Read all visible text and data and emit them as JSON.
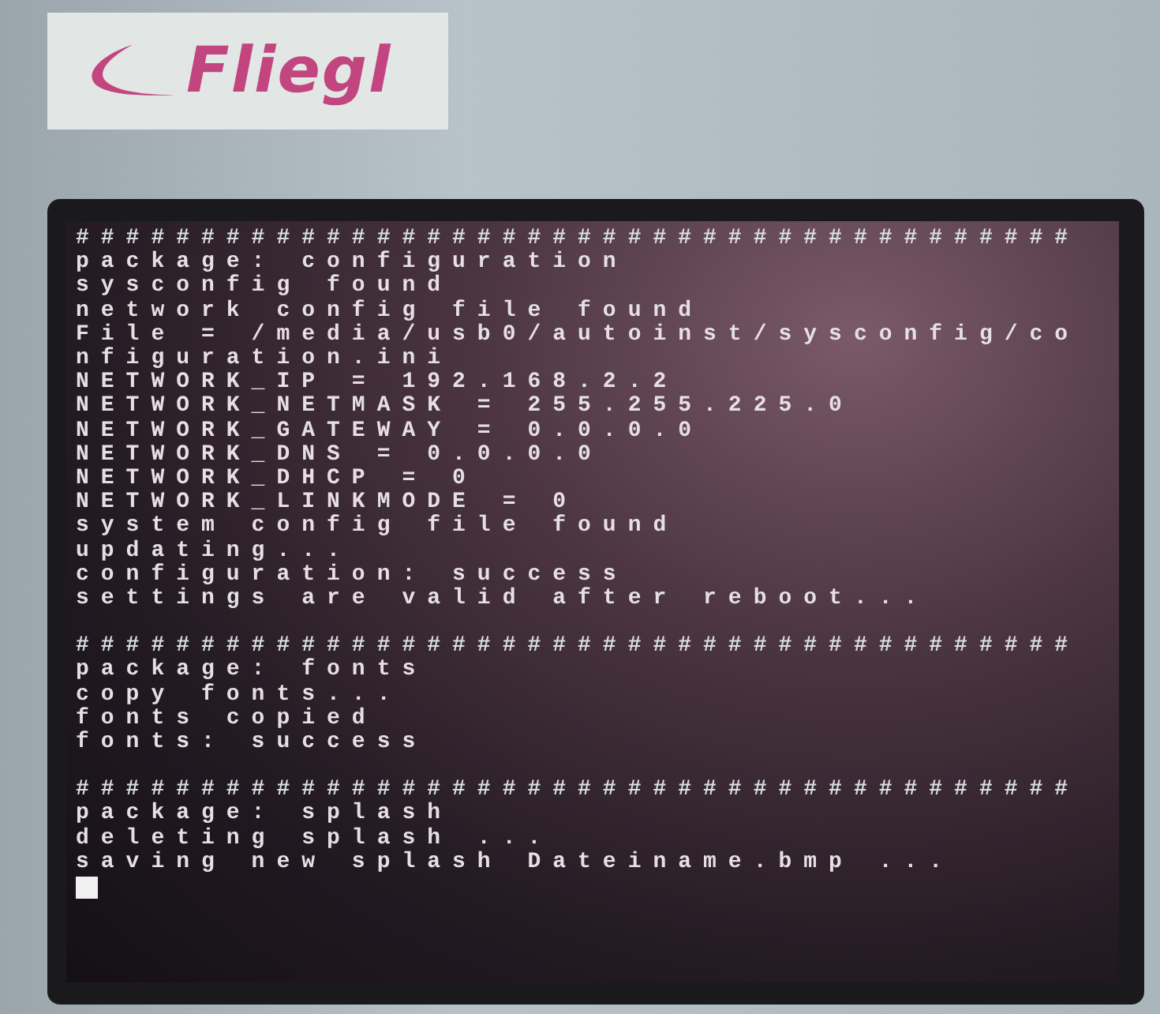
{
  "logo": {
    "text": "Fliegl"
  },
  "terminal": {
    "sections": [
      {
        "separator": "########################################",
        "lines": [
          "package: configuration",
          "sysconfig found",
          "network config file found",
          "File = /media/usb0/autoinst/sysconfig/co",
          "nfiguration.ini",
          "NETWORK_IP = 192.168.2.2",
          "NETWORK_NETMASK = 255.255.225.0",
          "NETWORK_GATEWAY = 0.0.0.0",
          "NETWORK_DNS = 0.0.0.0",
          "NETWORK_DHCP = 0",
          "NETWORK_LINKMODE = 0",
          "system config file found",
          "updating...",
          "configuration: success",
          "settings are valid after reboot..."
        ]
      },
      {
        "separator": "########################################",
        "lines": [
          "package: fonts",
          "copy fonts...",
          "fonts copied",
          "fonts: success"
        ]
      },
      {
        "separator": "########################################",
        "lines": [
          "package: splash",
          "deleting splash ...",
          "saving new splash Dateiname.bmp ..."
        ]
      }
    ],
    "cursor_visible": true
  }
}
